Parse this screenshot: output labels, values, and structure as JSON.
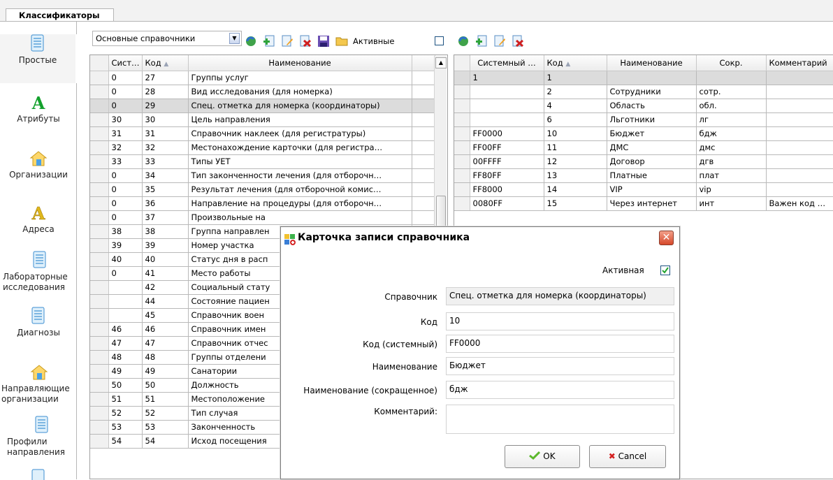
{
  "tabs": {
    "main": "Классификаторы"
  },
  "leftnav": [
    {
      "label": "Простые",
      "icon": "document-icon"
    },
    {
      "label": "Атрибуты",
      "icon": "letter-a-green-icon"
    },
    {
      "label": "Организации",
      "icon": "house-icon"
    },
    {
      "label": "Адреса",
      "icon": "letter-a-yellow-icon"
    },
    {
      "label": "Лабораторные исследования",
      "icon": "document-icon"
    },
    {
      "label": "Диагнозы",
      "icon": "document-icon"
    },
    {
      "label": "Направляющие организации",
      "icon": "house-icon"
    },
    {
      "label": "Профили направления",
      "icon": "document-icon"
    }
  ],
  "toolbar": {
    "combo_value": "Основные справочники",
    "active_label": "Активные"
  },
  "left_grid": {
    "columns": [
      "Сист…",
      "Код",
      "Наименование"
    ],
    "rows": [
      [
        "0",
        "27",
        "Группы услуг"
      ],
      [
        "0",
        "28",
        "Вид исследования (для номерка)"
      ],
      [
        "0",
        "29",
        "Спец. отметка для номерка (координаторы)"
      ],
      [
        "30",
        "30",
        "Цель направления"
      ],
      [
        "31",
        "31",
        "Справочник наклеек (для регистратуры)"
      ],
      [
        "32",
        "32",
        "Местонахождение карточки (для регистра…"
      ],
      [
        "33",
        "33",
        "Типы УЕТ"
      ],
      [
        "0",
        "34",
        "Тип законченности лечения (для отборочн…"
      ],
      [
        "0",
        "35",
        "Результат лечения (для отборочной комис…"
      ],
      [
        "0",
        "36",
        "Направление на процедуры (для отборочн…"
      ],
      [
        "0",
        "37",
        "Произвольные на"
      ],
      [
        "38",
        "38",
        "Группа направлен"
      ],
      [
        "39",
        "39",
        "Номер участка"
      ],
      [
        "40",
        "40",
        "Статус дня в расп"
      ],
      [
        "0",
        "41",
        "Место работы"
      ],
      [
        "",
        "42",
        "Социальный стату"
      ],
      [
        "",
        "44",
        "Состояние пациен"
      ],
      [
        "",
        "45",
        "Справочник воен"
      ],
      [
        "46",
        "46",
        "Справочник имен"
      ],
      [
        "47",
        "47",
        "Справочник отчес"
      ],
      [
        "48",
        "48",
        "Группы отделени"
      ],
      [
        "49",
        "49",
        "Санатории"
      ],
      [
        "50",
        "50",
        "Должность"
      ],
      [
        "51",
        "51",
        "Местоположение"
      ],
      [
        "52",
        "52",
        "Тип случая"
      ],
      [
        "53",
        "53",
        "Законченность"
      ],
      [
        "54",
        "54",
        "Исход посещения"
      ]
    ]
  },
  "right_grid": {
    "columns": [
      "Системный …",
      "Код",
      "Наименование",
      "Сокр.",
      "Комментарий"
    ],
    "rows": [
      [
        "1",
        "1",
        "",
        "",
        ""
      ],
      [
        "",
        "2",
        "Сотрудники",
        "сотр.",
        ""
      ],
      [
        "",
        "4",
        "Область",
        "обл.",
        ""
      ],
      [
        "",
        "6",
        "Льготники",
        "лг",
        ""
      ],
      [
        "FF0000",
        "10",
        "Бюджет",
        "бдж",
        ""
      ],
      [
        "FF00FF",
        "11",
        "ДМС",
        "дмс",
        ""
      ],
      [
        "00FFFF",
        "12",
        "Договор",
        "дгв",
        ""
      ],
      [
        "FF80FF",
        "13",
        "Платные",
        "плат",
        ""
      ],
      [
        "FF8000",
        "14",
        "VIP",
        "vip",
        ""
      ],
      [
        "0080FF",
        "15",
        "Через интернет",
        "инт",
        "Важен код …"
      ]
    ]
  },
  "dialog": {
    "title": "Карточка записи справочника",
    "active_label": "Активная",
    "labels": {
      "directory": "Справочник",
      "code": "Код",
      "system_code": "Код (системный)",
      "name": "Наименование",
      "short_name": "Наименование (сокращенное)",
      "comment": "Комментарий:"
    },
    "values": {
      "directory": "Спец. отметка для номерка (координаторы)",
      "code": "10",
      "system_code": "FF0000",
      "name": "Бюджет",
      "short_name": "бдж",
      "comment": ""
    },
    "ok_label": "OK",
    "cancel_label": "Cancel"
  }
}
